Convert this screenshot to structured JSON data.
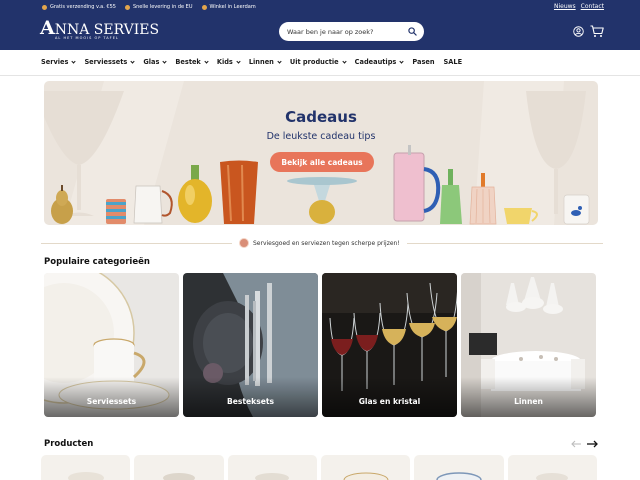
{
  "topbar": {
    "usps": [
      "Gratis verzending v.a. €55",
      "Snelle levering in de EU",
      "Winkel in Leerdam"
    ],
    "links": [
      "Nieuws",
      "Contact"
    ],
    "colors": {
      "background": "#22336b",
      "usp_icon": "#e3a54c"
    }
  },
  "logo": {
    "brand": "ANNA SERVIES",
    "brand_initial": "A",
    "brand_rest": "NNA SERVIES",
    "tagline": "AL HET MOOIS OP TAFEL"
  },
  "search": {
    "placeholder": "Waar ben je naar op zoek?",
    "icon": "search-icon"
  },
  "header_icons": [
    "user-icon",
    "cart-icon"
  ],
  "nav": {
    "items": [
      {
        "label": "Servies",
        "dropdown": true
      },
      {
        "label": "Serviessets",
        "dropdown": true
      },
      {
        "label": "Glas",
        "dropdown": true
      },
      {
        "label": "Bestek",
        "dropdown": true
      },
      {
        "label": "Kids",
        "dropdown": true
      },
      {
        "label": "Linnen",
        "dropdown": true
      },
      {
        "label": "Uit productie",
        "dropdown": true
      },
      {
        "label": "Cadeautips",
        "dropdown": true
      },
      {
        "label": "Pasen",
        "dropdown": false
      },
      {
        "label": "SALE",
        "dropdown": false
      }
    ]
  },
  "hero": {
    "title": "Cadeaus",
    "subtitle": "De leukste cadeau tips",
    "button": "Bekijk alle cadeaus",
    "colors": {
      "background": "#ebe4dc",
      "text": "#22336b",
      "button": "#e8755a"
    }
  },
  "promo": {
    "text": "Serviesgoed en serviezen tegen scherpe prijzen!"
  },
  "categories": {
    "title": "Populaire categorieën",
    "items": [
      {
        "label": "Serviessets"
      },
      {
        "label": "Besteksets"
      },
      {
        "label": "Glas en kristal"
      },
      {
        "label": "Linnen"
      }
    ]
  },
  "products": {
    "title": "Producten",
    "nav_icons": [
      "arrow-left-icon",
      "arrow-right-icon"
    ]
  }
}
